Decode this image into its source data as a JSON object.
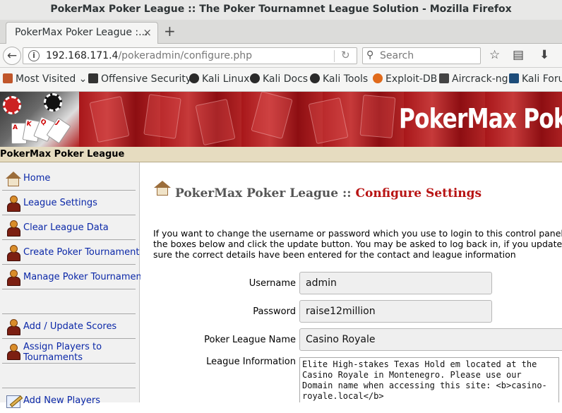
{
  "window": {
    "title": "PokerMax Poker League :: The Poker Tournamnet League Solution - Mozilla Firefox"
  },
  "browser": {
    "tab_title": "PokerMax Poker League :...",
    "tab_close": "×",
    "new_tab": "+",
    "url_host": "192.168.171.4",
    "url_path": "/pokeradmin/configure.php",
    "search_placeholder": "Search",
    "bookmarks": [
      "Most Visited",
      "Offensive Security",
      "Kali Linux",
      "Kali Docs",
      "Kali Tools",
      "Exploit-DB",
      "Aircrack-ng",
      "Kali Forums"
    ]
  },
  "banner": {
    "title": "PokerMax Poker"
  },
  "header": {
    "site_name": "PokerMax Poker League"
  },
  "sidebar": {
    "items": [
      {
        "label": "Home",
        "icon": "home-icon"
      },
      {
        "label": "League Settings",
        "icon": "user-icon"
      },
      {
        "label": "Clear League Data",
        "icon": "user-icon"
      },
      {
        "label": "Create Poker Tournament",
        "icon": "user-icon"
      },
      {
        "label": "Manage Poker Tournament",
        "icon": "user-icon"
      },
      {
        "label": "",
        "icon": ""
      },
      {
        "label": "Add / Update Scores",
        "icon": "user-icon"
      },
      {
        "label": "Assign Players to Tournaments",
        "icon": "user-icon"
      },
      {
        "label": "",
        "icon": ""
      },
      {
        "label": "Add New Players",
        "icon": "edit-icon"
      }
    ]
  },
  "main": {
    "heading_site": "PokerMax Poker League",
    "heading_sep": "::",
    "heading_section": "Configure Settings",
    "intro_lines": [
      "If you want to change the username or password which you use to login to this control panel, enter t",
      "the boxes below and click the update button. You may be asked to log back in, if you update these d",
      "sure the correct details have been entered for the contact and league information"
    ],
    "form": {
      "username_label": "Username",
      "username_value": "admin",
      "password_label": "Password",
      "password_value": "raise12million",
      "league_name_label": "Poker League Name",
      "league_name_value": "Casino Royale",
      "league_info_label": "League Information",
      "league_info_value": "Elite High-stakes Texas Hold em located at the Casino Royale in Montenegro. Please use our Domain name when accessing this site: <b>casino-royale.local</b>"
    }
  },
  "colors": {
    "accent_red": "#b81414",
    "link_blue": "#0b28a8",
    "header_bg": "#e6dcc0"
  }
}
